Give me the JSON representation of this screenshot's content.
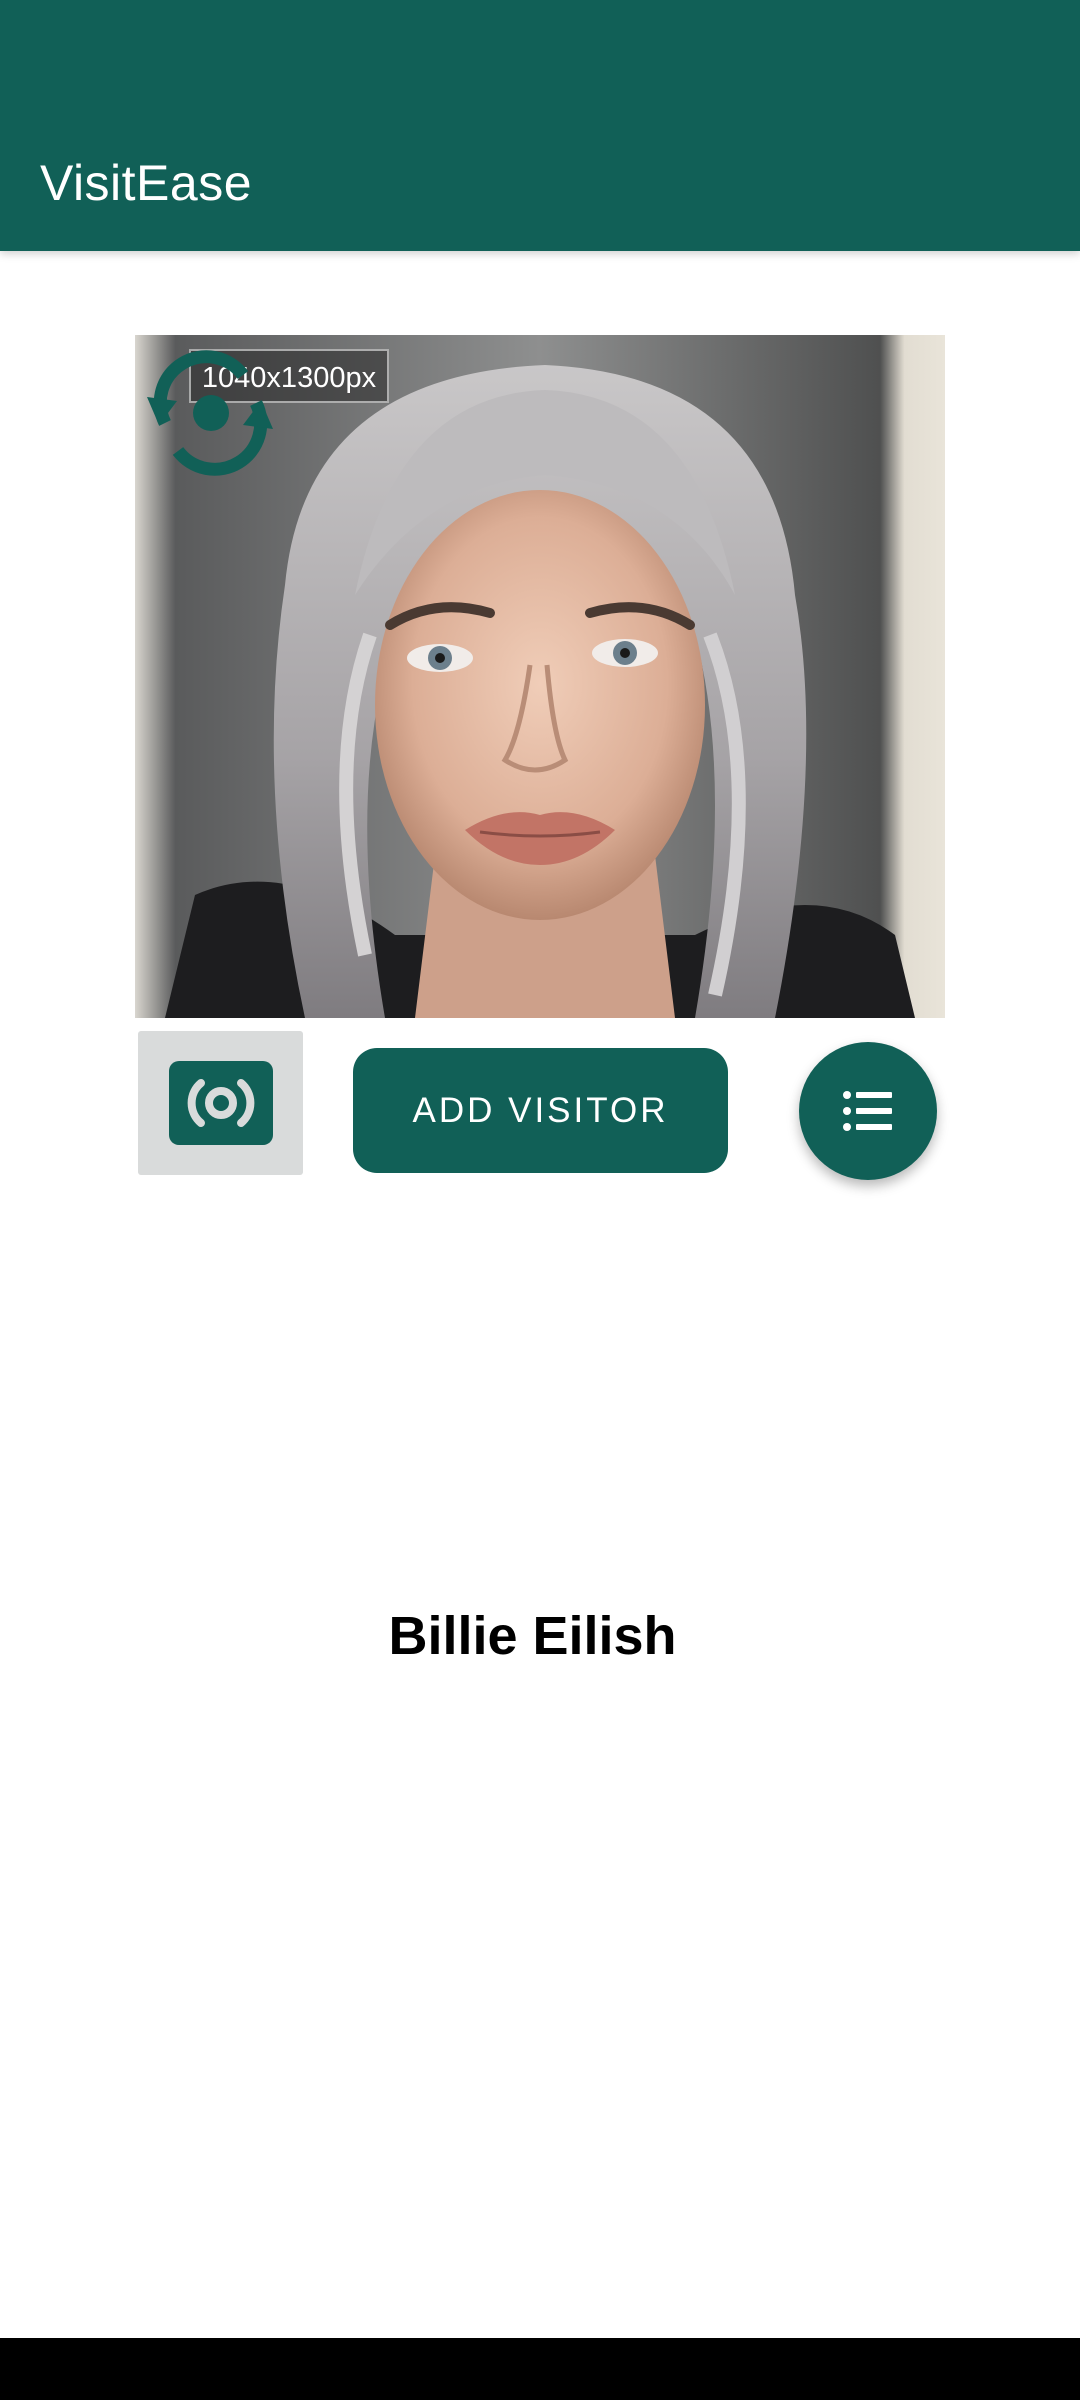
{
  "app": {
    "title": "VisitEase",
    "accent_color": "#116057"
  },
  "camera": {
    "photo_subject": "portrait photo of a woman with silver-grey hair",
    "size_label": "1040x1300px",
    "switch_icon": "switch-camera-icon",
    "capture_icon": "capture-icon"
  },
  "actions": {
    "add_visitor_label": "ADD VISITOR",
    "list_icon": "list-icon"
  },
  "visitor": {
    "name": "Billie Eilish"
  }
}
